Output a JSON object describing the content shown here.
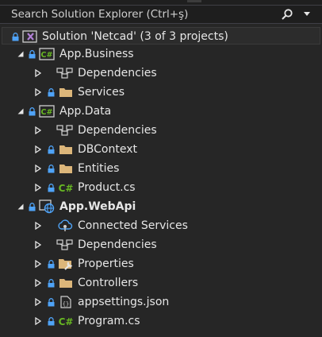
{
  "search": {
    "placeholder": "Search Solution Explorer (Ctrl+ş)"
  },
  "tree": {
    "solution": {
      "label": "Solution 'Netcad' (3 of 3 projects)"
    },
    "business": {
      "label": "App.Business",
      "dependencies": "Dependencies",
      "services": "Services"
    },
    "data": {
      "label": "App.Data",
      "dependencies": "Dependencies",
      "dbcontext": "DBContext",
      "entities": "Entities",
      "product": "Product.cs"
    },
    "webapi": {
      "label": "App.WebApi",
      "connected_services": "Connected Services",
      "dependencies": "Dependencies",
      "properties": "Properties",
      "controllers": "Controllers",
      "appsettings": "appsettings.json",
      "program": "Program.cs"
    }
  },
  "colors": {
    "background": "#262626",
    "folder": "#dcb67a",
    "csharp": "#68b723",
    "lock": "#4fa3f7",
    "text": "#e6e6e6",
    "solution_purple": "#b180d7"
  }
}
